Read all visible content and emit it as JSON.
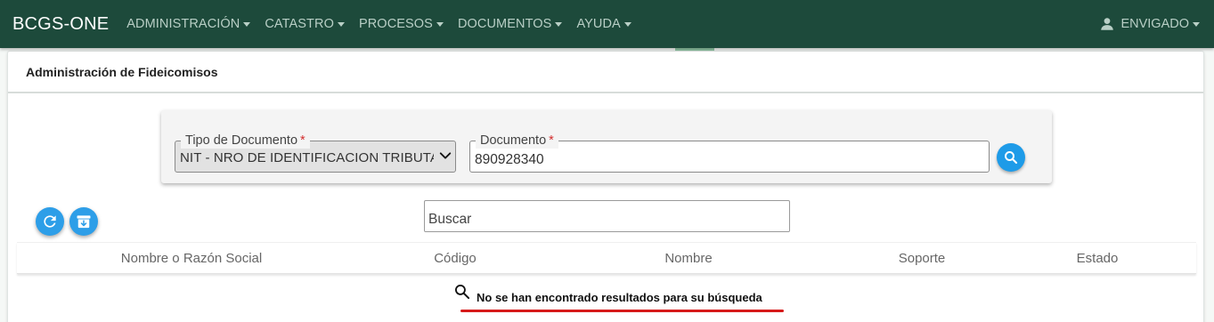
{
  "navbar": {
    "brand": "BCGS-ONE",
    "menu": [
      {
        "label": "ADMINISTRACIÓN"
      },
      {
        "label": "CATASTRO"
      },
      {
        "label": "PROCESOS"
      },
      {
        "label": "DOCUMENTOS"
      },
      {
        "label": "AYUDA"
      }
    ],
    "user": {
      "label": "ENVIGADO",
      "icon": "user-icon"
    }
  },
  "card": {
    "title": "Administración de Fideicomisos"
  },
  "form": {
    "tipo_documento": {
      "label": "Tipo de Documento",
      "required_mark": "*",
      "value": "NIT - NRO DE IDENTIFICACION TRIBUTARIA"
    },
    "documento": {
      "label": "Documento",
      "required_mark": "*",
      "value": "890928340"
    },
    "search_icon": "search-icon"
  },
  "actions": {
    "refresh_icon": "refresh-icon",
    "archive_icon": "archive-download-icon"
  },
  "buscar": {
    "placeholder": "Buscar"
  },
  "table": {
    "columns": [
      "Nombre o Razón Social",
      "Código",
      "Nombre",
      "Soporte",
      "Estado"
    ],
    "empty_message": "No se han encontrado resultados para su búsqueda"
  },
  "colors": {
    "navbar_bg": "#1d4a3b",
    "button_blue": "#2d9ee8",
    "error_underline": "#d61a1a"
  }
}
